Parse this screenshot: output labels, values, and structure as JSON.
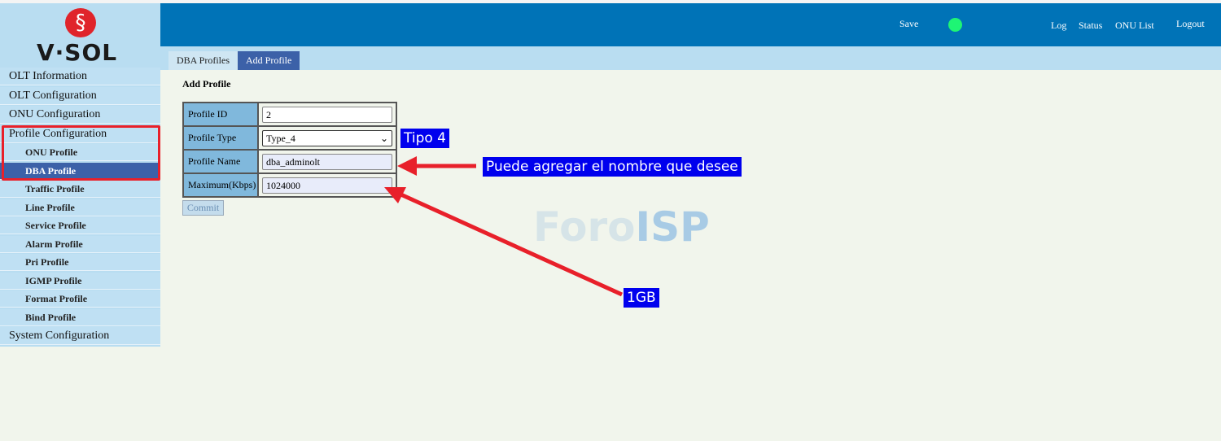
{
  "brand": {
    "logo_text": "V·SOL"
  },
  "header": {
    "save": "Save",
    "status_dot_color": "#1ef574",
    "links": [
      "Log",
      "Status",
      "ONU List",
      "Logout"
    ]
  },
  "tabs": [
    {
      "label": "DBA Profiles",
      "active": false
    },
    {
      "label": "Add Profile",
      "active": true
    }
  ],
  "sidebar": {
    "items": [
      {
        "label": "OLT Information"
      },
      {
        "label": "OLT Configuration"
      },
      {
        "label": "ONU Configuration"
      },
      {
        "label": "Profile Configuration"
      },
      {
        "label": "ONU Profile"
      },
      {
        "label": "DBA Profile",
        "active": true
      },
      {
        "label": "Traffic Profile"
      },
      {
        "label": "Line Profile"
      },
      {
        "label": "Service Profile"
      },
      {
        "label": "Alarm Profile"
      },
      {
        "label": "Pri Profile"
      },
      {
        "label": "IGMP Profile"
      },
      {
        "label": "Format Profile"
      },
      {
        "label": "Bind Profile"
      },
      {
        "label": "System Configuration"
      }
    ]
  },
  "form": {
    "title": "Add Profile",
    "profile_id_label": "Profile ID",
    "profile_id": "2",
    "profile_type_label": "Profile Type",
    "profile_type": "Type_4",
    "profile_name_label": "Profile Name",
    "profile_name": "dba_adminolt",
    "max_label": "Maximum(Kbps)",
    "max": "1024000",
    "commit": "Commit"
  },
  "annotations": {
    "type": "Tipo 4",
    "name": "Puede agregar el nombre que desee",
    "max": "1GB"
  },
  "watermark": "ForoISP"
}
